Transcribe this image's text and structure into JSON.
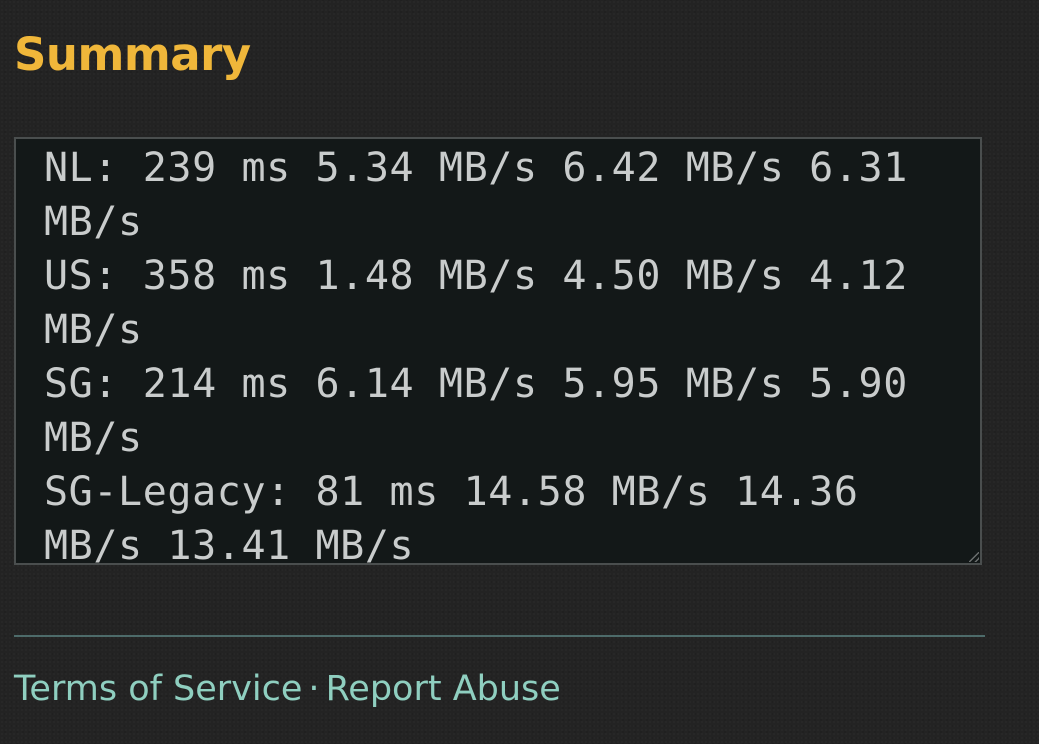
{
  "section": {
    "title": "Summary"
  },
  "summary": {
    "lines": [
      "NL: 239 ms 5.34 MB/s 6.42 MB/s 6.31 MB/s",
      "US: 358 ms 1.48 MB/s 4.50 MB/s 4.12 MB/s",
      "SG: 214 ms 6.14 MB/s 5.95 MB/s 5.90 MB/s",
      "SG-Legacy: 81 ms 14.58 MB/s 14.36 MB/s 13.41 MB/s"
    ]
  },
  "footer": {
    "terms_label": "Terms of Service",
    "separator": "·",
    "report_label": "Report Abuse"
  },
  "colors": {
    "heading": "#f0b73a",
    "link": "#8fcfc0",
    "background": "#232323",
    "box_background": "#131818"
  }
}
